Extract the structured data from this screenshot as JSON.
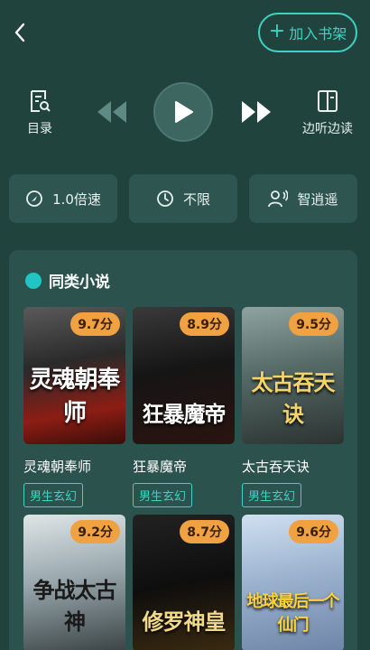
{
  "header": {
    "add_shelf_label": "加入书架"
  },
  "controls": {
    "toc_label": "目录",
    "listen_label": "边听边读"
  },
  "options": {
    "speed": "1.0倍速",
    "timer": "不限",
    "voice": "智逍遥"
  },
  "section": {
    "title": "同类小说"
  },
  "books": [
    {
      "title": "灵魂朝奉师",
      "score": "9.7分",
      "tag": "男生玄幻",
      "cover_text": "灵魂朝奉师"
    },
    {
      "title": "狂暴魔帝",
      "score": "8.9分",
      "tag": "男生玄幻",
      "cover_text": "狂暴魔帝"
    },
    {
      "title": "太古吞天诀",
      "score": "9.5分",
      "tag": "男生玄幻",
      "cover_text": "太古吞天诀"
    },
    {
      "title": "",
      "score": "9.2分",
      "tag": "",
      "cover_text": "争战太古神"
    },
    {
      "title": "",
      "score": "8.7分",
      "tag": "",
      "cover_text": "修罗神皇"
    },
    {
      "title": "",
      "score": "9.6分",
      "tag": "",
      "cover_text": "地球最后一个仙门"
    }
  ],
  "colors": {
    "background": "#21433e",
    "accent": "#3fd1c3",
    "score_badge": "#f0a142"
  }
}
